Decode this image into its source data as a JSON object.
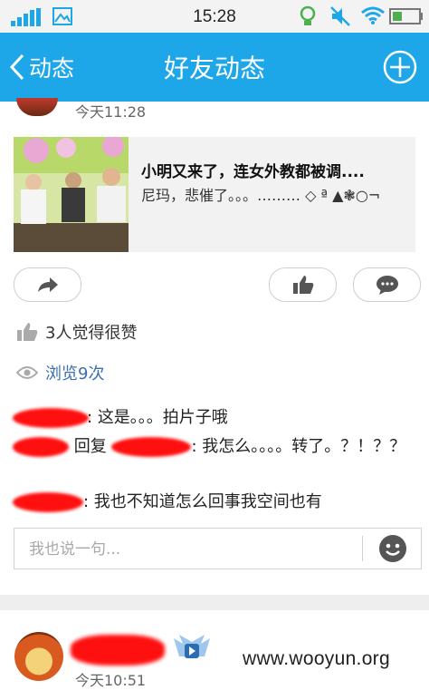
{
  "status_bar": {
    "time": "15:28"
  },
  "nav": {
    "back_label": "动态",
    "title": "好友动态"
  },
  "post1": {
    "time": "今天11:28",
    "share": {
      "title": "小明又来了，连女外教都被调....",
      "desc": "尼玛，悲催了。。。……… ◇ ª ▲❃○¬"
    },
    "likes": "3人觉得很赞",
    "views": "浏览9次",
    "comments": [
      {
        "text": "这是。。。拍片子哦"
      },
      {
        "reply_label": "回复",
        "text": "我怎么。。。。转了。？！？？"
      },
      {
        "text": "我也不知道怎么回事我空间也有"
      }
    ],
    "comment_input": {
      "placeholder": "我也说一句..."
    }
  },
  "post2": {
    "time": "今天10:51"
  },
  "watermark": "www.wooyun.org",
  "colors": {
    "nav_bg": "#1ea7e8",
    "link": "#3a6fb0",
    "redaction": "#ff1010"
  }
}
